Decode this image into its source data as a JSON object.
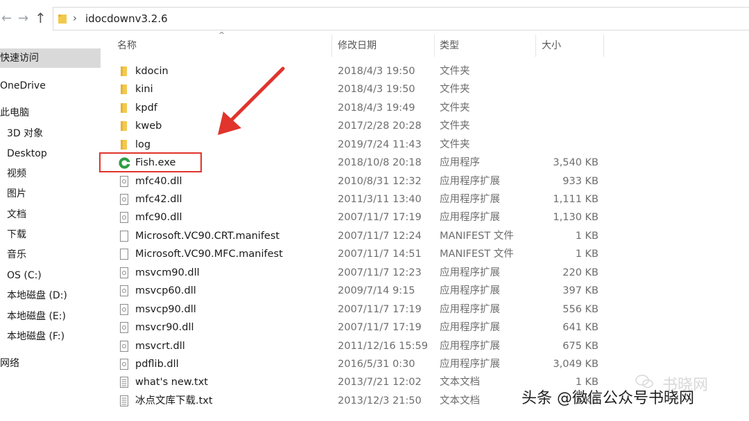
{
  "address_bar": {
    "path_segment": "idocdownv3.2.6"
  },
  "sidebar": {
    "items": [
      {
        "label": "快速访问",
        "selected": true
      },
      {
        "label": "OneDrive"
      },
      {
        "label": "此电脑"
      },
      {
        "label": "3D 对象"
      },
      {
        "label": "Desktop"
      },
      {
        "label": "视频"
      },
      {
        "label": "图片"
      },
      {
        "label": "文档"
      },
      {
        "label": "下载"
      },
      {
        "label": "音乐"
      },
      {
        "label": "OS (C:)"
      },
      {
        "label": "本地磁盘 (D:)"
      },
      {
        "label": "本地磁盘 (E:)"
      },
      {
        "label": "本地磁盘 (F:)"
      },
      {
        "label": "网络"
      }
    ]
  },
  "columns": {
    "name": "名称",
    "date": "修改日期",
    "type": "类型",
    "size": "大小"
  },
  "files": [
    {
      "name": "kdocin",
      "date": "2018/4/3 19:50",
      "type": "文件夹",
      "size": "",
      "icon": "folder-icon"
    },
    {
      "name": "kini",
      "date": "2018/4/3 19:50",
      "type": "文件夹",
      "size": "",
      "icon": "folder-icon"
    },
    {
      "name": "kpdf",
      "date": "2018/4/3 19:49",
      "type": "文件夹",
      "size": "",
      "icon": "folder-icon"
    },
    {
      "name": "kweb",
      "date": "2017/2/28 20:28",
      "type": "文件夹",
      "size": "",
      "icon": "folder-icon"
    },
    {
      "name": "log",
      "date": "2019/7/24 11:43",
      "type": "文件夹",
      "size": "",
      "icon": "folder-icon"
    },
    {
      "name": "Fish.exe",
      "date": "2018/10/8 20:18",
      "type": "应用程序",
      "size": "3,540 KB",
      "icon": "fish-app-icon"
    },
    {
      "name": "mfc40.dll",
      "date": "2010/8/31 12:32",
      "type": "应用程序扩展",
      "size": "933 KB",
      "icon": "dll-file-icon"
    },
    {
      "name": "mfc42.dll",
      "date": "2011/3/11 13:40",
      "type": "应用程序扩展",
      "size": "1,111 KB",
      "icon": "dll-file-icon"
    },
    {
      "name": "mfc90.dll",
      "date": "2007/11/7 17:19",
      "type": "应用程序扩展",
      "size": "1,130 KB",
      "icon": "dll-file-icon"
    },
    {
      "name": "Microsoft.VC90.CRT.manifest",
      "date": "2007/11/7 12:24",
      "type": "MANIFEST 文件",
      "size": "1 KB",
      "icon": "blank-file-icon"
    },
    {
      "name": "Microsoft.VC90.MFC.manifest",
      "date": "2007/11/7 14:51",
      "type": "MANIFEST 文件",
      "size": "1 KB",
      "icon": "blank-file-icon"
    },
    {
      "name": "msvcm90.dll",
      "date": "2007/11/7 12:23",
      "type": "应用程序扩展",
      "size": "220 KB",
      "icon": "dll-file-icon"
    },
    {
      "name": "msvcp60.dll",
      "date": "2009/7/14 9:15",
      "type": "应用程序扩展",
      "size": "397 KB",
      "icon": "dll-file-icon"
    },
    {
      "name": "msvcp90.dll",
      "date": "2007/11/7 17:19",
      "type": "应用程序扩展",
      "size": "556 KB",
      "icon": "dll-file-icon"
    },
    {
      "name": "msvcr90.dll",
      "date": "2007/11/7 17:19",
      "type": "应用程序扩展",
      "size": "641 KB",
      "icon": "dll-file-icon"
    },
    {
      "name": "msvcrt.dll",
      "date": "2011/12/16 15:59",
      "type": "应用程序扩展",
      "size": "675 KB",
      "icon": "dll-file-icon"
    },
    {
      "name": "pdflib.dll",
      "date": "2016/5/31 0:30",
      "type": "应用程序扩展",
      "size": "3,049 KB",
      "icon": "dll-file-icon"
    },
    {
      "name": "what's new.txt",
      "date": "2013/7/21 12:02",
      "type": "文本文档",
      "size": "1 KB",
      "icon": "text-file-icon"
    },
    {
      "name": "冰点文库下载.txt",
      "date": "2013/12/3 21:50",
      "type": "文本文档",
      "size": "1 KB",
      "icon": "text-file-icon"
    }
  ],
  "watermark": {
    "text": "头条 @微信公众号书晓网",
    "faint_text": "书晓网"
  },
  "colors": {
    "highlight": "#e0342c",
    "folder": "#f2c94c",
    "fish_green": "#2e9e44"
  }
}
